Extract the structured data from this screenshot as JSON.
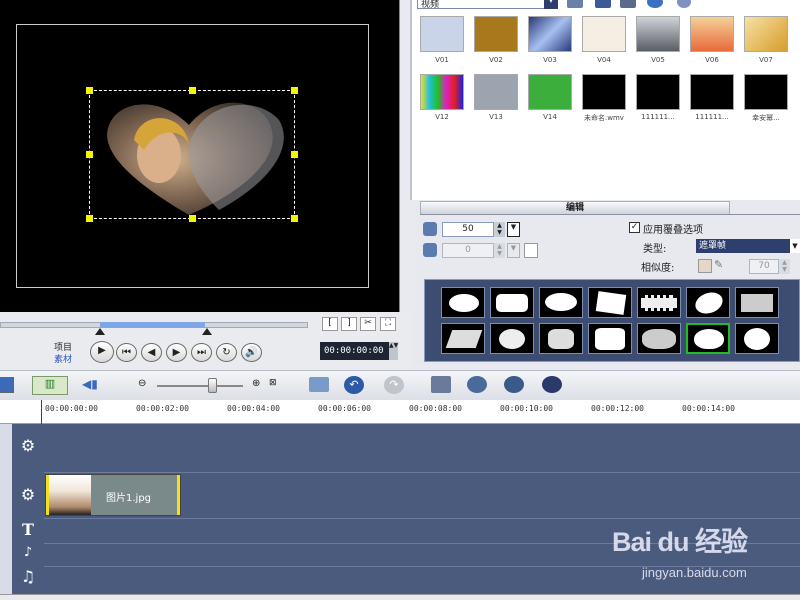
{
  "library": {
    "category": "视频",
    "thumbs": [
      {
        "label": "V01",
        "color": "#c9d4e8"
      },
      {
        "label": "V02",
        "color": "#a8781c"
      },
      {
        "label": "V03",
        "color": "#6c8cc8"
      },
      {
        "label": "V04",
        "color": "#f4efe2"
      },
      {
        "label": "V05",
        "color": "#8a8e94"
      },
      {
        "label": "V06",
        "color": "#e6a35a"
      },
      {
        "label": "V07",
        "color": "#e0b84a"
      },
      {
        "label": "V12",
        "color": "#6aa66a"
      },
      {
        "label": "V13",
        "color": "#9ca4b0"
      },
      {
        "label": "V14",
        "color": "#3cae3c"
      },
      {
        "label": "未命名.wmv",
        "color": "#000000"
      },
      {
        "label": "111111...",
        "color": "#000000"
      },
      {
        "label": "111111...",
        "color": "#000000"
      },
      {
        "label": "幸安幂...",
        "color": "#000000"
      }
    ]
  },
  "edit": {
    "tab_title": "编辑",
    "value1": "50",
    "value2": "0",
    "overlay_option": "应用覆叠选项",
    "type_label": "类型:",
    "type_value": "遮罩帧",
    "similarity_label": "相似度:",
    "similarity_value": "70"
  },
  "controls": {
    "project_label": "项目",
    "clip_label": "素材",
    "timecode": "00:00:00:00"
  },
  "ruler": {
    "ticks": [
      "00:00:00:00",
      "00:00:02:00",
      "00:00:04:00",
      "00:00:06:00",
      "00:00:08:00",
      "00:00:10:00",
      "00:00:12:00",
      "00:00:14:00"
    ]
  },
  "timeline": {
    "clip_name": "图片1.jpg"
  },
  "watermark": {
    "brand": "Bai du 经验",
    "url": "jingyan.baidu.com"
  },
  "colors": {
    "accent_green": "#22bb22",
    "handle_yellow": "#f5f500",
    "timeline_bg": "#4b5b7d",
    "select_blue": "#2e3f6e"
  }
}
